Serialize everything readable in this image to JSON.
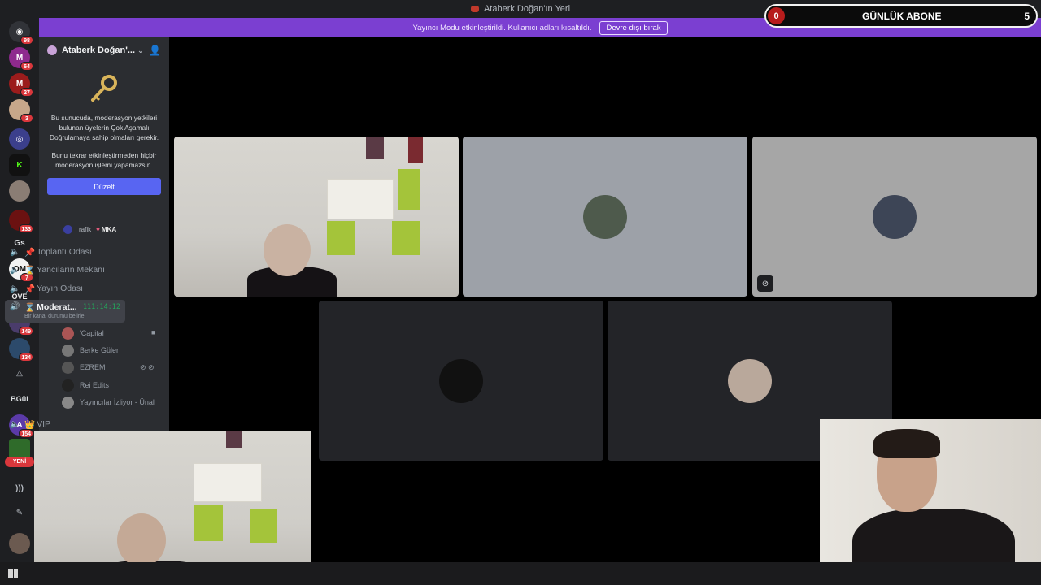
{
  "window": {
    "title": "Ataberk Doğan'ın Yeri"
  },
  "banner": {
    "message": "Yayıncı Modu etkinleştirildi. Kullanıcı adları kısaltıldı.",
    "disable_button": "Devre dışı bırak"
  },
  "subscriber_overlay": {
    "left_count": "0",
    "label": "GÜNLÜK ABONE",
    "right_count": "5"
  },
  "rail": {
    "new_label": "YENİ",
    "servers": [
      {
        "name": "discord-home",
        "badge": "98"
      },
      {
        "name": "server-m-pink",
        "badge": "64"
      },
      {
        "name": "server-m-red",
        "badge": "27"
      },
      {
        "name": "server-photo-1",
        "badge": "3"
      },
      {
        "name": "server-discord-blue",
        "badge": ""
      },
      {
        "name": "server-kick",
        "badge": ""
      },
      {
        "name": "server-photo-2",
        "badge": ""
      },
      {
        "name": "server-red",
        "badge": "133"
      },
      {
        "name": "server-gs",
        "text": "Gs",
        "badge": ""
      },
      {
        "name": "server-om",
        "badge": "7"
      },
      {
        "name": "server-ove",
        "badge": "13"
      },
      {
        "name": "server-photo-3",
        "badge": "149"
      },
      {
        "name": "server-photo-4",
        "badge": "134"
      },
      {
        "name": "server-triangle",
        "badge": ""
      },
      {
        "name": "server-bgul",
        "text": "BGül",
        "badge": ""
      },
      {
        "name": "server-purple",
        "badge": "154"
      },
      {
        "name": "server-green",
        "badge": ""
      }
    ]
  },
  "sidebar": {
    "guild_name": "Ataberk Doğan'...",
    "mfa_text_1": "Bu sunucuda, moderasyon yetkileri bulunan üyelerin Çok Aşamalı Doğrulamaya sahip olmaları gerekir.",
    "mfa_text_2": "Bunu tekrar etkinleştirmeden hiçbir moderasyon işlemi yapamazsın.",
    "fix_button": "Düzelt",
    "top_member": {
      "name": "rafik",
      "tag": "MKA"
    },
    "channels": [
      {
        "label": "Toplantı Odası",
        "prefix": "📌"
      },
      {
        "label": "Yancıların Mekanı",
        "prefix": "⌛"
      },
      {
        "label": "Yayın Odası",
        "prefix": "📌"
      },
      {
        "label": "Moderat...",
        "prefix": "⌛",
        "timer": "111:14:12",
        "status": "Bir kanal durumu belirle"
      }
    ],
    "members": [
      {
        "name": "'Capital",
        "right": "■"
      },
      {
        "name": "Berke Güler",
        "right": ""
      },
      {
        "name": "EZREM",
        "right": "⊘ ⊘"
      },
      {
        "name": "Rei Edits",
        "right": ""
      },
      {
        "name": "Yayıncılar İzliyor - Ünal",
        "right": ""
      }
    ],
    "vip_channel": {
      "label": "VIP",
      "prefix": "👑"
    }
  }
}
